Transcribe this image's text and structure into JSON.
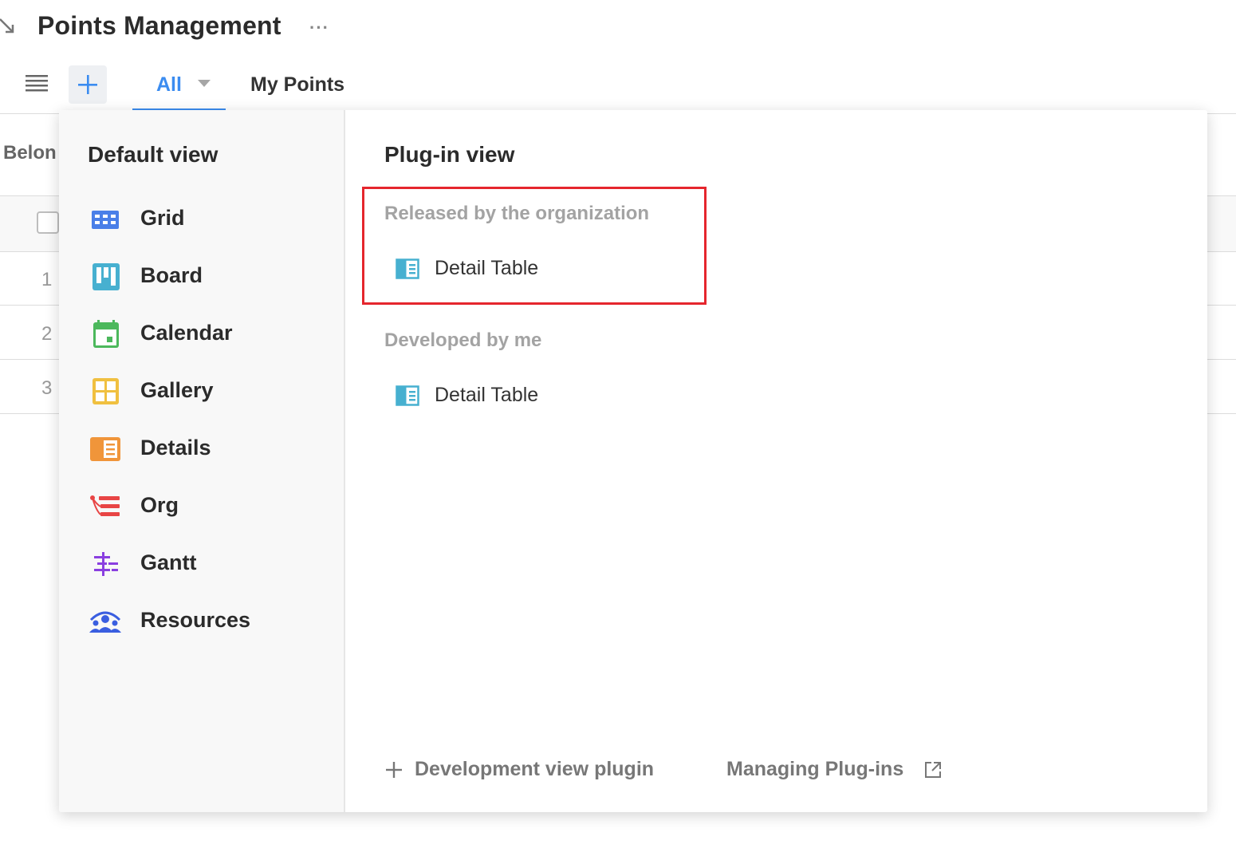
{
  "header": {
    "title": "Points Management",
    "more_label": "···"
  },
  "toolbar": {
    "tabs": [
      {
        "label": "All",
        "active": true
      },
      {
        "label": "My Points",
        "active": false
      }
    ]
  },
  "background_table": {
    "column_header": "Belon",
    "row_numbers": [
      "1",
      "2",
      "3"
    ]
  },
  "panel": {
    "default_view": {
      "title": "Default view",
      "items": [
        {
          "label": "Grid",
          "icon": "grid-icon",
          "color": "#4a7fe8"
        },
        {
          "label": "Board",
          "icon": "board-icon",
          "color": "#47b0d0"
        },
        {
          "label": "Calendar",
          "icon": "calendar-icon",
          "color": "#4cb85c"
        },
        {
          "label": "Gallery",
          "icon": "gallery-icon",
          "color": "#f0c040"
        },
        {
          "label": "Details",
          "icon": "details-icon",
          "color": "#f0953a"
        },
        {
          "label": "Org",
          "icon": "org-icon",
          "color": "#e84545"
        },
        {
          "label": "Gantt",
          "icon": "gantt-icon",
          "color": "#8a3fe0"
        },
        {
          "label": "Resources",
          "icon": "resources-icon",
          "color": "#3a5ee0"
        }
      ]
    },
    "plugin_view": {
      "title": "Plug-in view",
      "groups": [
        {
          "label": "Released by the organization",
          "items": [
            {
              "label": "Detail Table",
              "icon": "detail-table-icon"
            }
          ]
        },
        {
          "label": "Developed by me",
          "items": [
            {
              "label": "Detail Table",
              "icon": "detail-table-icon"
            }
          ]
        }
      ],
      "footer": {
        "develop_label": "Development view plugin",
        "manage_label": "Managing Plug-ins"
      }
    }
  },
  "colors": {
    "accent": "#3b8cf0",
    "highlight": "#e5262d",
    "plugin_icon": "#47b0d0"
  }
}
